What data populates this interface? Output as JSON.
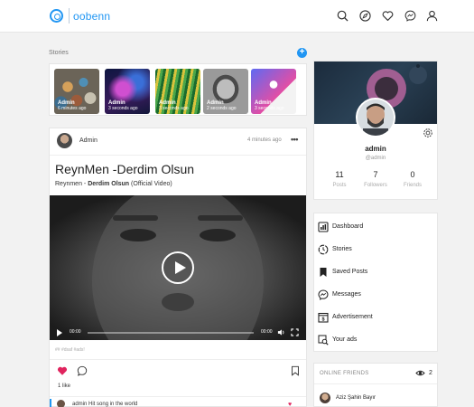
{
  "header": {
    "logo_text": "oobenn",
    "accent": "#2196f3",
    "nav_icons": [
      "search-icon",
      "explore-icon",
      "heart-icon",
      "messenger-icon",
      "user-icon"
    ]
  },
  "stories": {
    "title": "Stories",
    "add_label": "+",
    "items": [
      {
        "user": "Admin",
        "time": "6 minutes ago"
      },
      {
        "user": "Admin",
        "time": "3 seconds ago"
      },
      {
        "user": "Admin",
        "time": "3 seconds ago"
      },
      {
        "user": "Admin",
        "time": "2 seconds ago"
      },
      {
        "user": "Admin",
        "time": "3 seconds ago"
      }
    ]
  },
  "post": {
    "user": "Admin",
    "time": "4 minutes ago",
    "more": "•••",
    "title": "ReynMen -Derdim Olsun",
    "desc_prefix": "Reynmen - ",
    "desc_bold": "Derdim Olsun",
    "desc_suffix": " (Official Video)",
    "video": {
      "current_time": "00:00",
      "duration": "00:00"
    },
    "hashtags": "## #dsaf #ads!",
    "likes": "1 like",
    "comment": {
      "user": "admin",
      "text": "Hit song in the world"
    }
  },
  "profile": {
    "name": "admin",
    "handle": "@admin",
    "stats": [
      {
        "value": "11",
        "label": "Posts"
      },
      {
        "value": "7",
        "label": "Followers"
      },
      {
        "value": "0",
        "label": "Friends"
      }
    ]
  },
  "menu": {
    "items": [
      {
        "label": "Dashboard",
        "icon": "dashboard-icon"
      },
      {
        "label": "Stories",
        "icon": "stories-icon"
      },
      {
        "label": "Saved Posts",
        "icon": "bookmark-icon"
      },
      {
        "label": "Messages",
        "icon": "messenger-icon"
      },
      {
        "label": "Advertisement",
        "icon": "advertisement-icon"
      },
      {
        "label": "Your ads",
        "icon": "search-ads-icon"
      }
    ]
  },
  "online_friends": {
    "title": "ONLINE FRIENDS",
    "count": "2",
    "friends": [
      {
        "name": "Aziz Şahin Bayır"
      }
    ]
  }
}
